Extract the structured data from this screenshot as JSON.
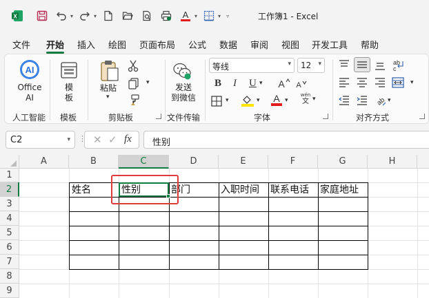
{
  "window": {
    "title": "工作簿1 - Excel"
  },
  "menu": [
    "文件",
    "开始",
    "插入",
    "绘图",
    "页面布局",
    "公式",
    "数据",
    "审阅",
    "视图",
    "开发工具",
    "帮助"
  ],
  "ribbon": {
    "office_ai": {
      "label1": "Office",
      "label2": "AI",
      "group": "人工智能"
    },
    "template": {
      "label1": "模",
      "label2": "板",
      "group": "模板"
    },
    "paste": {
      "label": "粘贴",
      "group": "剪贴板"
    },
    "send": {
      "label1": "发送",
      "label2": "到微信",
      "group": "文件传输"
    },
    "font": {
      "name": "等线",
      "size": "12",
      "group": "字体",
      "bold": "B",
      "italic": "I",
      "underline": "U",
      "wen": "wén",
      "wen2": "文"
    },
    "align": {
      "group": "对齐方式"
    }
  },
  "formula_bar": {
    "cell_ref": "C2",
    "fx": "fx",
    "value": "性别"
  },
  "grid": {
    "columns": [
      "A",
      "B",
      "C",
      "D",
      "E",
      "F",
      "G",
      "H"
    ],
    "rows": [
      "1",
      "2",
      "3",
      "4",
      "5",
      "6",
      "7",
      "8",
      "9"
    ],
    "headers": [
      "姓名",
      "性别",
      "部门",
      "入职时间",
      "联系电话",
      "家庭地址"
    ]
  },
  "colors": {
    "accent": "#107c41",
    "highlight_box": "#e03a3a"
  }
}
